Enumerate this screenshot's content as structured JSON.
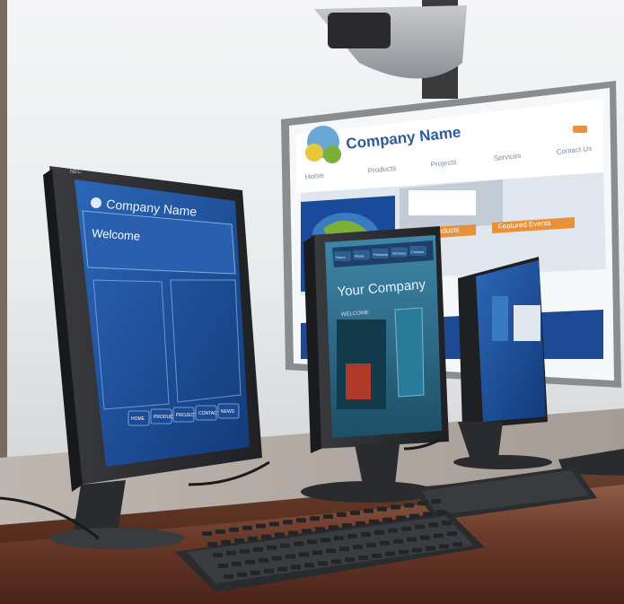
{
  "projection": {
    "brand": "Company Name",
    "tagline": "",
    "nav": [
      "Home",
      "Products",
      "Projects",
      "Services",
      "Contact Us"
    ],
    "sections": [
      "New Products",
      "Featured Events"
    ]
  },
  "monitor_left": {
    "make": "NEC",
    "brand": "Company Name",
    "heading": "Welcome",
    "nav": [
      "HOME",
      "PRODUCTS",
      "PROJECTS",
      "CONTACT",
      "NEWS"
    ]
  },
  "monitor_middle": {
    "tabs": [
      "Home",
      "About",
      "Products",
      "Services",
      "Contact"
    ],
    "brand": "Your Company",
    "subheading": "WELCOME"
  },
  "colors": {
    "projection_accent": "#e8913a",
    "left_screen": "#1c4f9c",
    "middle_screen": "#2a6a8a",
    "monitor_bezel": "#2a2b2e",
    "desk": "#6b3a2a"
  }
}
